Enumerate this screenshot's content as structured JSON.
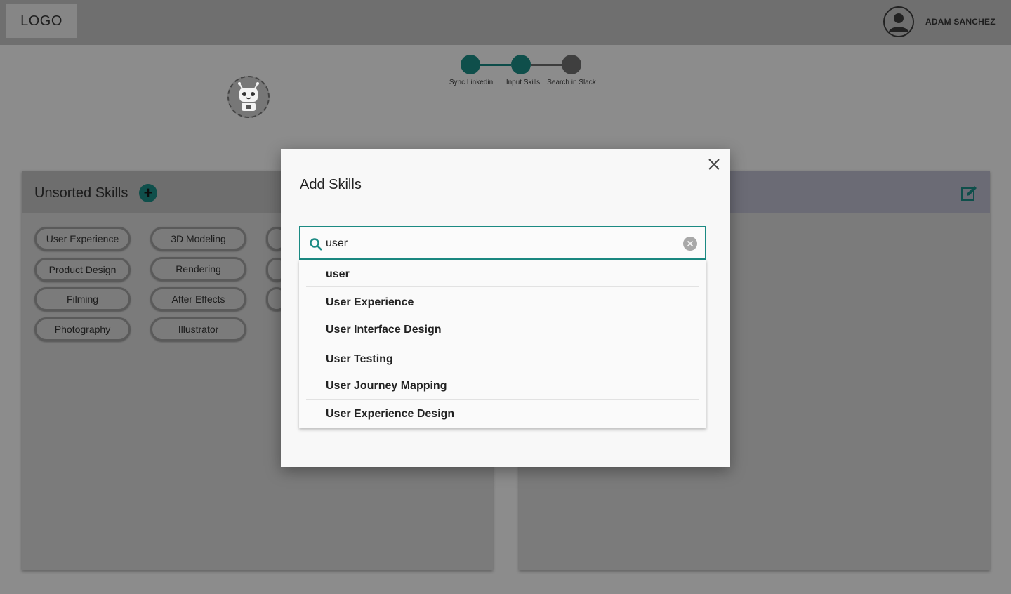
{
  "header": {
    "logo": "LOGO",
    "user_name": "ADAM SANCHEZ"
  },
  "stepper": {
    "steps": [
      {
        "label": "Sync Linkedin",
        "state": "complete"
      },
      {
        "label": "Input Skills",
        "state": "complete"
      },
      {
        "label": "Search in Slack",
        "state": "pending"
      }
    ]
  },
  "left_panel": {
    "title": "Unsorted Skills",
    "add_icon": "plus-circle-icon",
    "chips": [
      "User Experience",
      "3D Modeling",
      "Product Design",
      "Rendering",
      "Filming",
      "After Effects",
      "Photography",
      "Illustrator"
    ]
  },
  "right_panel": {
    "edit_icon": "edit-icon"
  },
  "modal": {
    "title": "Add Skills",
    "close_icon": "close-icon",
    "search": {
      "value": "user",
      "icon": "search-icon",
      "clear_icon": "clear-icon"
    },
    "suggestions": [
      "user",
      "User Experience",
      "User Interface Design",
      "User Testing",
      "User Journey Mapping",
      "User Experience Design"
    ]
  },
  "colors": {
    "accent": "#1b8a83",
    "overlay_bg": "#8c8c8c",
    "modal_bg": "#f8f8f8"
  }
}
